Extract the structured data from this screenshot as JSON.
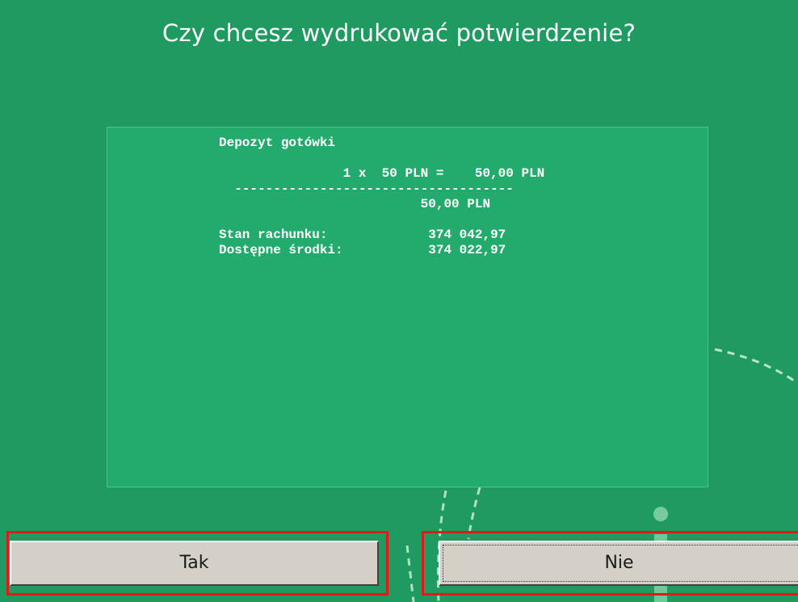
{
  "dialog": {
    "title": "Czy chcesz wydrukować potwierdzenie?"
  },
  "receipt": {
    "heading": "Depozyt gotówki",
    "line_item": "1 x  50 PLN =    50,00 PLN",
    "separator": "------------------------------------",
    "total": "50,00 PLN",
    "balance_label": "Stan rachunku:",
    "balance_value": "374 042,97",
    "available_label": "Dostępne środki:",
    "available_value": "374 022,97"
  },
  "buttons": {
    "yes_label": "Tak",
    "no_label": "Nie"
  },
  "colors": {
    "background": "#1f9a61",
    "receipt_panel": "#23ab6e",
    "button_face": "#d4d0c8",
    "highlight": "#e0191a"
  }
}
